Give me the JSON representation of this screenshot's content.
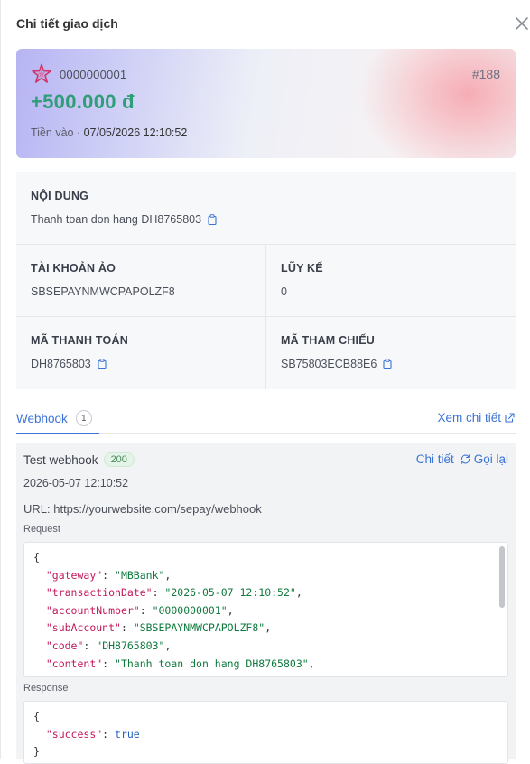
{
  "header": {
    "title": "Chi tiết giao dịch"
  },
  "hero": {
    "account": "0000000001",
    "id": "#188",
    "amount": "+500.000 đ",
    "type": "Tiền vào",
    "separator": " · ",
    "datetime": "07/05/2026 12:10:52"
  },
  "info": {
    "content": {
      "label": "NỘI DUNG",
      "value": "Thanh toan don hang DH8765803"
    },
    "virtual_account": {
      "label": "TÀI KHOẢN ẢO",
      "value": "SBSEPAYNMWCPAPOLZF8"
    },
    "cumulative": {
      "label": "LŨY KẾ",
      "value": "0"
    },
    "payment_code": {
      "label": "MÃ THANH TOÁN",
      "value": "DH8765803"
    },
    "reference_code": {
      "label": "MÃ THAM CHIẾU",
      "value": "SB75803ECB88E6"
    }
  },
  "tabs": {
    "webhook_label": "Webhook",
    "webhook_count": "1",
    "view_detail": "Xem chi tiết"
  },
  "webhook": {
    "title": "Test webhook",
    "status": "200",
    "detail_label": "Chi tiết",
    "retry_label": "Gọi lại",
    "time": "2026-05-07 12:10:52",
    "url": "URL: https://yourwebsite.com/sepay/webhook",
    "request_label": "Request",
    "response_label": "Response",
    "request": {
      "open": "{",
      "fields": [
        {
          "key": "\"gateway\"",
          "value": "\"MBBank\""
        },
        {
          "key": "\"transactionDate\"",
          "value": "\"2026-05-07 12:10:52\""
        },
        {
          "key": "\"accountNumber\"",
          "value": "\"0000000001\""
        },
        {
          "key": "\"subAccount\"",
          "value": "\"SBSEPAYNMWCPAPOLZF8\""
        },
        {
          "key": "\"code\"",
          "value": "\"DH8765803\""
        },
        {
          "key": "\"content\"",
          "value": "\"Thanh toan don hang DH8765803\""
        }
      ]
    },
    "response": {
      "open": "{",
      "key": "\"success\"",
      "value": "true",
      "close": "}"
    }
  },
  "colors": {
    "accent": "#3b73d6",
    "amount": "#2f9e78",
    "json_key": "#c2185b",
    "json_string": "#0f7a3d"
  },
  "icons": {
    "close": "close-icon",
    "logo": "star-logo-icon",
    "copy": "copy-icon",
    "external": "external-link-icon",
    "retry": "refresh-icon"
  }
}
